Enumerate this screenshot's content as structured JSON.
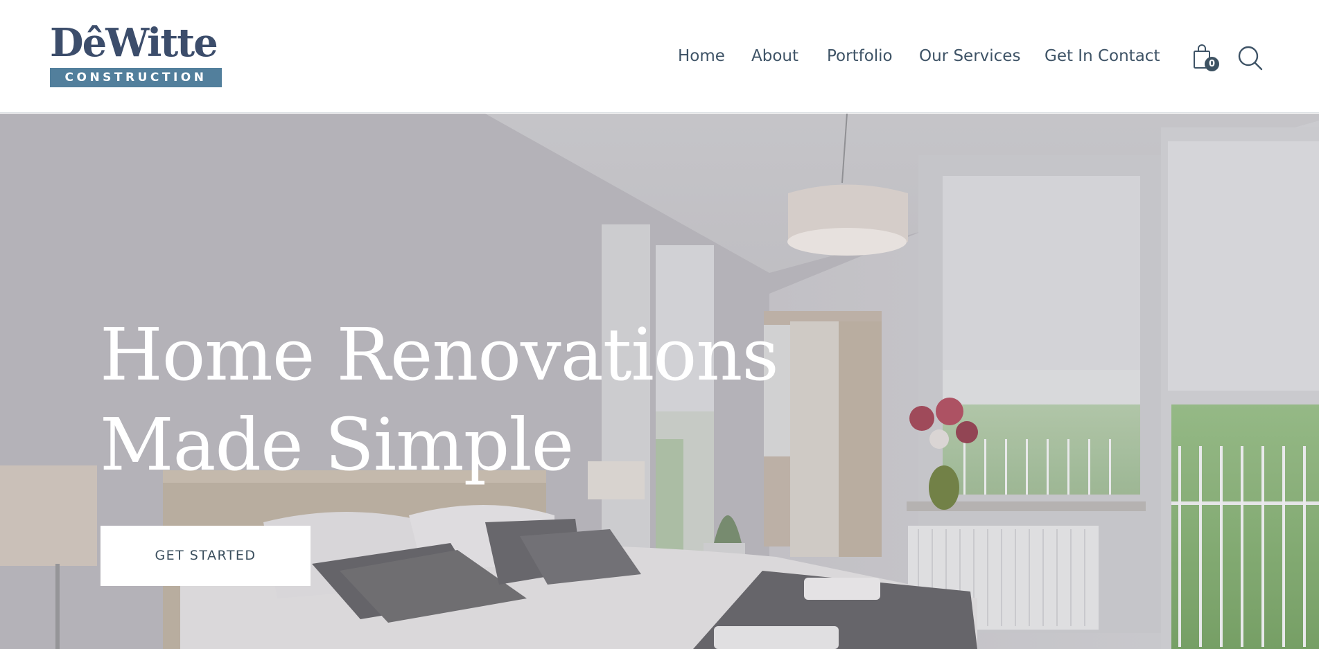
{
  "brand": {
    "name": "DeWitte",
    "name_display": "DêWitte",
    "subtitle": "CONSTRUCTION",
    "primary_color": "#3c4d6b",
    "accent_color": "#527f9c"
  },
  "nav": {
    "items": [
      {
        "label": "Home"
      },
      {
        "label": "About"
      },
      {
        "label": "Portfolio"
      },
      {
        "label": "Our Services"
      },
      {
        "label": "Get In Contact"
      }
    ],
    "text_color": "#3e5366"
  },
  "cart": {
    "icon": "shopping-bag-icon",
    "count": "0"
  },
  "search": {
    "icon": "search-icon"
  },
  "hero": {
    "title_line1": "Home Renovations",
    "title_line2": "Made Simple",
    "cta_label": "GET STARTED",
    "background": "bedroom-photo"
  }
}
